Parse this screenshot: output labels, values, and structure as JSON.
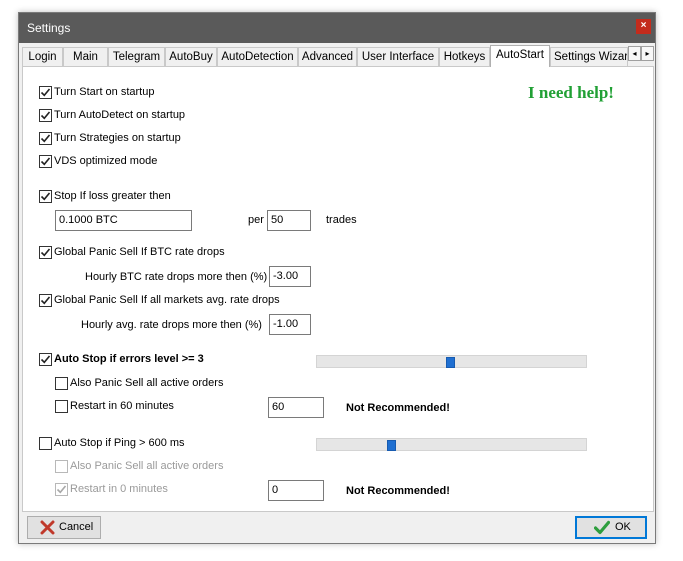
{
  "window": {
    "title": "Settings",
    "close_icon": "×"
  },
  "tabs": [
    "Login",
    "Main",
    "Telegram",
    "AutoBuy",
    "AutoDetection",
    "Advanced",
    "User Interface",
    "Hotkeys",
    "AutoStart",
    "Settings Wizard"
  ],
  "active_tab": "AutoStart",
  "tab_scroll": {
    "left": "◂",
    "right": "▸"
  },
  "help_link": "I need help!",
  "startup": {
    "start": {
      "label": "Turn Start on startup",
      "checked": true
    },
    "autodetect": {
      "label": "Turn AutoDetect on startup",
      "checked": true
    },
    "strategies": {
      "label": "Turn Strategies on startup",
      "checked": true
    },
    "vds": {
      "label": "VDS optimized mode",
      "checked": true
    }
  },
  "stop_loss": {
    "label": "Stop If loss greater then",
    "checked": true,
    "amount": "0.1000 BTC",
    "per_label": "per",
    "per_value": "50",
    "trades_label": "trades"
  },
  "panic_btc": {
    "label": "Global Panic Sell If BTC rate drops",
    "checked": true,
    "hourly_label": "Hourly BTC rate drops more then (%)",
    "hourly_value": "-3.00"
  },
  "panic_markets": {
    "label": "Global Panic Sell If all markets avg. rate drops",
    "checked": true,
    "hourly_label": "Hourly avg. rate drops more then (%)",
    "hourly_value": "-1.00"
  },
  "auto_stop_errors": {
    "label": "Auto Stop if errors level >= 3",
    "checked": true,
    "slider_level": 0.5,
    "panic_label": "Also Panic Sell all active orders",
    "panic_checked": false,
    "restart_label": "Restart in 60 minutes",
    "restart_checked": false,
    "restart_value": "60",
    "warning": "Not Recommended!"
  },
  "auto_stop_ping": {
    "label": "Auto Stop if Ping > 600 ms",
    "checked": false,
    "slider_level": 0.27,
    "panic_label": "Also Panic Sell all active orders",
    "panic_checked": false,
    "restart_label": "Restart in 0 minutes",
    "restart_checked": true,
    "restart_value": "0",
    "warning": "Not Recommended!"
  },
  "buttons": {
    "cancel": "Cancel",
    "ok": "OK"
  },
  "colors": {
    "help": "#21a035",
    "accent": "#0078d7",
    "titlebar": "#5a5a5a",
    "close": "#c42b1c",
    "cancel_icon": "#c0392b",
    "ok_icon": "#2e9e3e"
  }
}
